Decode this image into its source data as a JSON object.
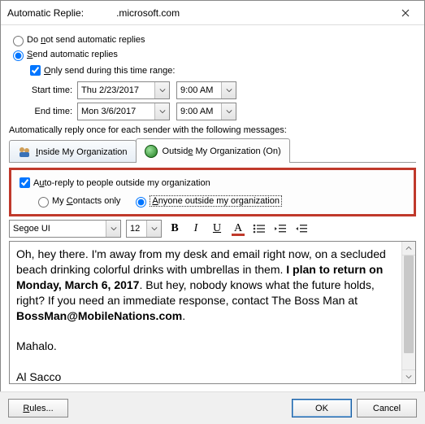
{
  "window": {
    "title_prefix": "Automatic Replie:",
    "title_suffix": ".microsoft.com"
  },
  "options": {
    "do_not_send": "Do not send automatic replies",
    "send": "Send automatic replies",
    "only_send_range": "Only send during this time range:",
    "start_label": "Start time:",
    "end_label": "End time:",
    "start_date": "Thu 2/23/2017",
    "start_time": "9:00 AM",
    "end_date": "Mon 3/6/2017",
    "end_time": "9:00 AM"
  },
  "auto_reply_msg": "Automatically reply once for each sender with the following messages:",
  "tabs": {
    "inside": "Inside My Organization",
    "outside": "Outside My Organization (On)"
  },
  "outside": {
    "auto_reply_people": "Auto-reply to people outside my organization",
    "contacts_only": "My Contacts only",
    "anyone": "Anyone outside my organization"
  },
  "editor": {
    "font": "Segoe UI",
    "size": "12",
    "line1a": "Oh, hey there. I'm away from my desk and email right now, on a secluded beach drinking colorful drinks with umbrellas in them. ",
    "line1b": "I plan to return on Monday, March 6, 2017",
    "line1c": ". But hey, nobody knows what the future holds, right? If you need an immediate response, contact The Boss Man at ",
    "line1d": "BossMan@MobileNations.com",
    "line1e": ".",
    "line2": "Mahalo.",
    "line3": "Al Sacco"
  },
  "footer": {
    "rules": "Rules...",
    "ok": "OK",
    "cancel": "Cancel"
  }
}
